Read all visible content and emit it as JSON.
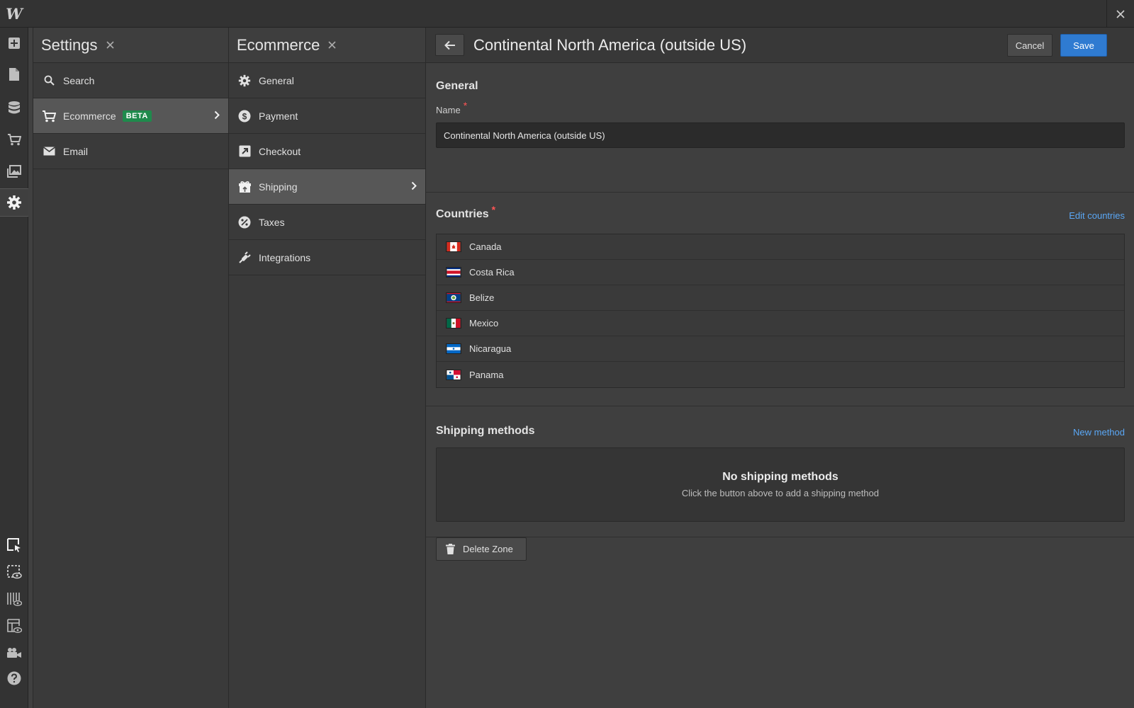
{
  "app": {
    "logo": "W"
  },
  "settings_pane": {
    "title": "Settings",
    "items": [
      {
        "label": "Search",
        "icon": "search-icon"
      },
      {
        "label": "Ecommerce",
        "icon": "cart-icon",
        "badge": "BETA",
        "selected": true
      },
      {
        "label": "Email",
        "icon": "mail-icon"
      }
    ]
  },
  "ecommerce_pane": {
    "title": "Ecommerce",
    "items": [
      {
        "label": "General",
        "icon": "gear-icon"
      },
      {
        "label": "Payment",
        "icon": "dollar-icon"
      },
      {
        "label": "Checkout",
        "icon": "checkout-icon"
      },
      {
        "label": "Shipping",
        "icon": "gift-icon",
        "selected": true
      },
      {
        "label": "Taxes",
        "icon": "percent-icon"
      },
      {
        "label": "Integrations",
        "icon": "plug-icon"
      }
    ]
  },
  "main": {
    "title": "Continental North America (outside US)",
    "cancel_label": "Cancel",
    "save_label": "Save",
    "general": {
      "title": "General",
      "name_label": "Name",
      "required_mark": "*",
      "name_value": "Continental North America (outside US)"
    },
    "countries": {
      "title": "Countries",
      "required_mark": "*",
      "edit_link": "Edit countries",
      "items": [
        {
          "name": "Canada",
          "flag": "flag-canada-icon"
        },
        {
          "name": "Costa Rica",
          "flag": "flag-costa-rica-icon"
        },
        {
          "name": "Belize",
          "flag": "flag-belize-icon"
        },
        {
          "name": "Mexico",
          "flag": "flag-mexico-icon"
        },
        {
          "name": "Nicaragua",
          "flag": "flag-nicaragua-icon"
        },
        {
          "name": "Panama",
          "flag": "flag-panama-icon"
        }
      ]
    },
    "shipping_methods": {
      "title": "Shipping methods",
      "new_link": "New method",
      "empty_title": "No shipping methods",
      "empty_subtitle": "Click the button above to add a shipping method"
    },
    "delete_label": "Delete Zone"
  },
  "colors": {
    "accent": "#2f7bd1",
    "link": "#5aa7f5",
    "badge": "#1f8a4c",
    "required": "#ff5555"
  }
}
